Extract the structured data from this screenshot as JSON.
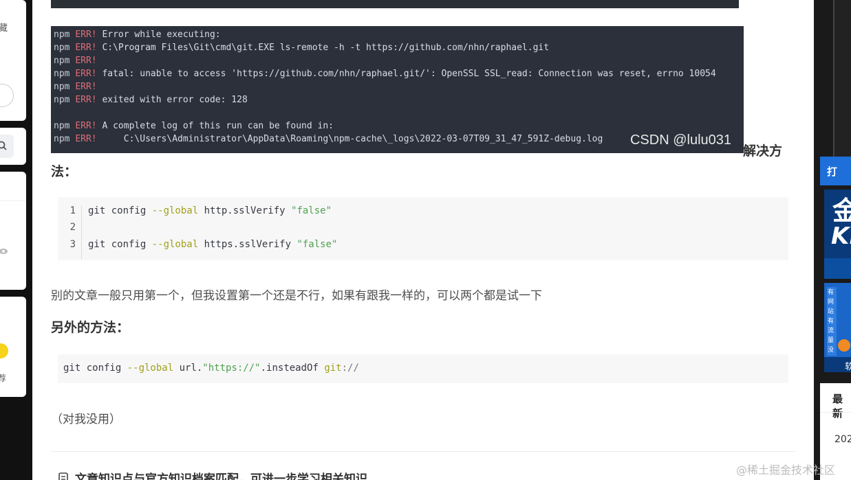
{
  "left_sidebar": {
    "card1_text": "藏",
    "card5_text": "荐"
  },
  "terminal": {
    "lines": [
      {
        "prefix": "npm",
        "tag": "ERR!",
        "text": " Error while executing:"
      },
      {
        "prefix": "npm",
        "tag": "ERR!",
        "text": " C:\\Program Files\\Git\\cmd\\git.EXE ls-remote -h -t https://github.com/nhn/raphael.git"
      },
      {
        "prefix": "npm",
        "tag": "ERR!",
        "text": ""
      },
      {
        "prefix": "npm",
        "tag": "ERR!",
        "text": " fatal: unable to access 'https://github.com/nhn/raphael.git/': OpenSSL SSL_read: Connection was reset, errno 10054"
      },
      {
        "prefix": "npm",
        "tag": "ERR!",
        "text": ""
      },
      {
        "prefix": "npm",
        "tag": "ERR!",
        "text": " exited with error code: 128"
      },
      {
        "prefix": "",
        "tag": "",
        "text": ""
      },
      {
        "prefix": "npm",
        "tag": "ERR!",
        "text": " A complete log of this run can be found in:"
      },
      {
        "prefix": "npm",
        "tag": "ERR!",
        "text": "     C:\\Users\\Administrator\\AppData\\Roaming\\npm-cache\\_logs\\2022-03-07T09_31_47_591Z-debug.log"
      }
    ],
    "watermark": "CSDN @lulu031"
  },
  "article": {
    "heading_tail": "解决方",
    "heading_start": "法：",
    "code1": {
      "line_numbers": [
        "1",
        "2",
        "3"
      ],
      "line1": {
        "a": "git config ",
        "kw": "--global",
        "b": " http.sslVerify ",
        "str": "\"false\""
      },
      "line3": {
        "a": "git config ",
        "kw": "--global",
        "b": " https.sslVerify ",
        "str": "\"false\""
      }
    },
    "paragraph": "别的文章一般只用第一个，但我设置第一个还是不行，如果有跟我一样的，可以两个都是试一下",
    "subheading": "另外的方法：",
    "code2": {
      "a": "git config ",
      "kw": "--global",
      "b": " url.",
      "str": "\"https://\"",
      "c": ".insteadOf ",
      "kw2": "git",
      "d": "://"
    },
    "note": "（对我没用）",
    "kb_text": "文章知识点与官方知识档案匹配，可进一步学习相关知识"
  },
  "right_sidebar": {
    "blue_button": "打",
    "ad1_big": "金",
    "ad1_big2": "Ki",
    "ad2_vertical": "有网站有流量没",
    "ad2_strip": "软",
    "latest_label": "最新",
    "latest_item": "202"
  },
  "site_watermark": "@稀土掘金技术社区"
}
